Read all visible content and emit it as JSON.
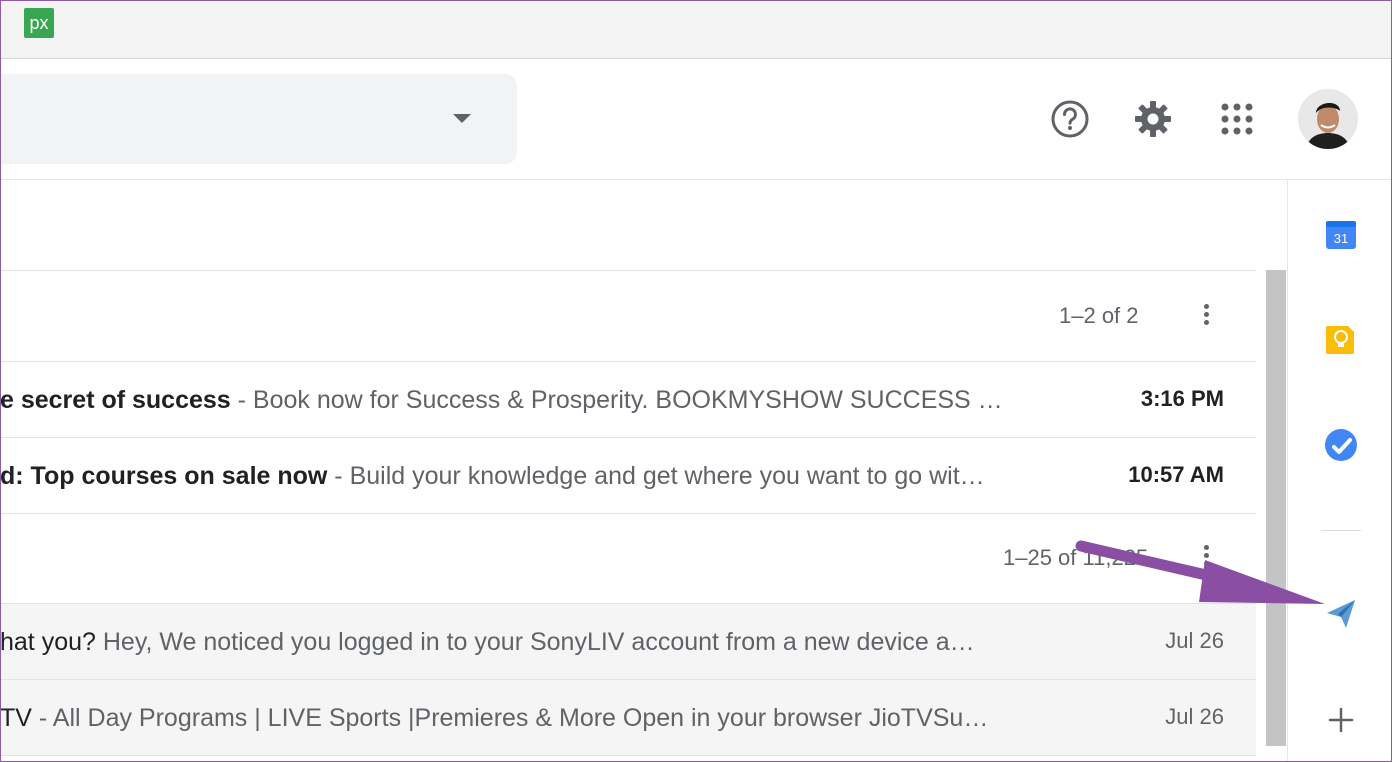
{
  "app": {
    "logo_text": "px"
  },
  "header": {
    "icons": [
      "help-icon",
      "gear-icon",
      "apps-grid-icon"
    ]
  },
  "lists": [
    {
      "range": "1–2 of 2",
      "emails": [
        {
          "subject": "e secret of success",
          "snippet": "Book now for Success & Prosperity. BOOKMYSHOW SUCCESS …",
          "date": "3:16 PM",
          "unread": true
        },
        {
          "subject": "d: Top courses on sale now",
          "snippet": "Build your knowledge and get where you want to go wit…",
          "date": "10:57 AM",
          "unread": true
        }
      ]
    },
    {
      "range": "1–25 of 11,225",
      "emails": [
        {
          "subject": "hat you?",
          "snippet": "Hey, We noticed you logged in to your SonyLIV account from a new device a…",
          "date": "Jul 26",
          "unread": false
        },
        {
          "subject": "TV",
          "snippet": "All Day Programs | LIVE Sports |Premieres & More Open in your browser JioTVSu…",
          "date": "Jul 26",
          "unread": false
        }
      ]
    }
  ],
  "side_panel": {
    "calendar_day": "31",
    "icons": [
      "calendar-icon",
      "keep-icon",
      "tasks-icon",
      "send-icon",
      "add-icon"
    ]
  },
  "colors": {
    "annotation_arrow": "#8a4fa3",
    "calendar_blue": "#4285f4",
    "keep_yellow": "#fbbc04",
    "tasks_blue": "#4285f4"
  }
}
